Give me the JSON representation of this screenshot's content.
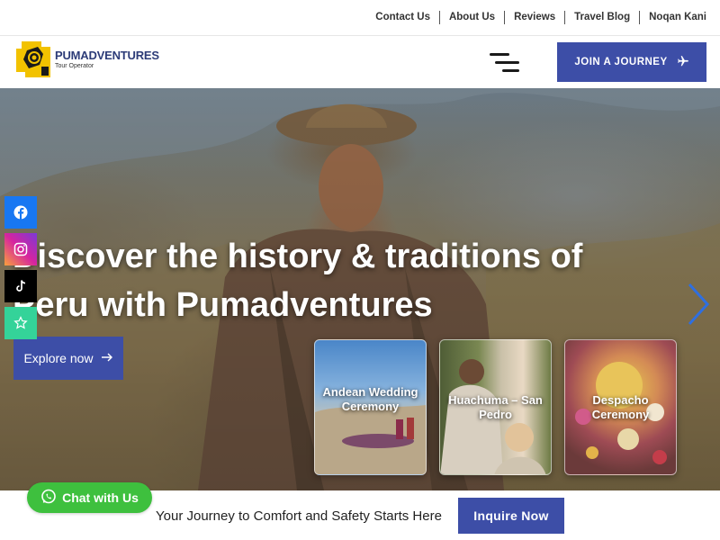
{
  "top_nav": {
    "links": [
      "Contact Us",
      "About Us",
      "Reviews",
      "Travel Blog",
      "Noqan Kani"
    ]
  },
  "header": {
    "logo_name": "PUMADVENTURES",
    "logo_sub": "Tour Operator",
    "join_label": "JOIN A JOURNEY",
    "menu_icon": "menu-icon",
    "plane_icon": "plane-icon"
  },
  "hero": {
    "title": "Discover the history & traditions of Peru with Pumadventures",
    "explore_label": "Explore now",
    "next_icon": "chevron-right-icon",
    "cards": [
      {
        "label": "Andean Wedding Ceremony"
      },
      {
        "label": "Huachuma – San Pedro"
      },
      {
        "label": "Despacho Ceremony"
      }
    ]
  },
  "social": {
    "icons": [
      "facebook-icon",
      "instagram-icon",
      "tiktok-icon",
      "star-icon"
    ]
  },
  "bottom": {
    "tagline": "Your Journey to Comfort and Safety Starts Here",
    "inquire_label": "Inquire Now",
    "chat_label": "Chat with Us",
    "chat_icon": "whatsapp-icon"
  },
  "colors": {
    "brand_blue": "#3d4ea7",
    "chat_green": "#3ec03e",
    "facebook": "#1877f2",
    "instagram": "#c13584",
    "tiktok": "#000000",
    "reviews": "#34d399"
  }
}
